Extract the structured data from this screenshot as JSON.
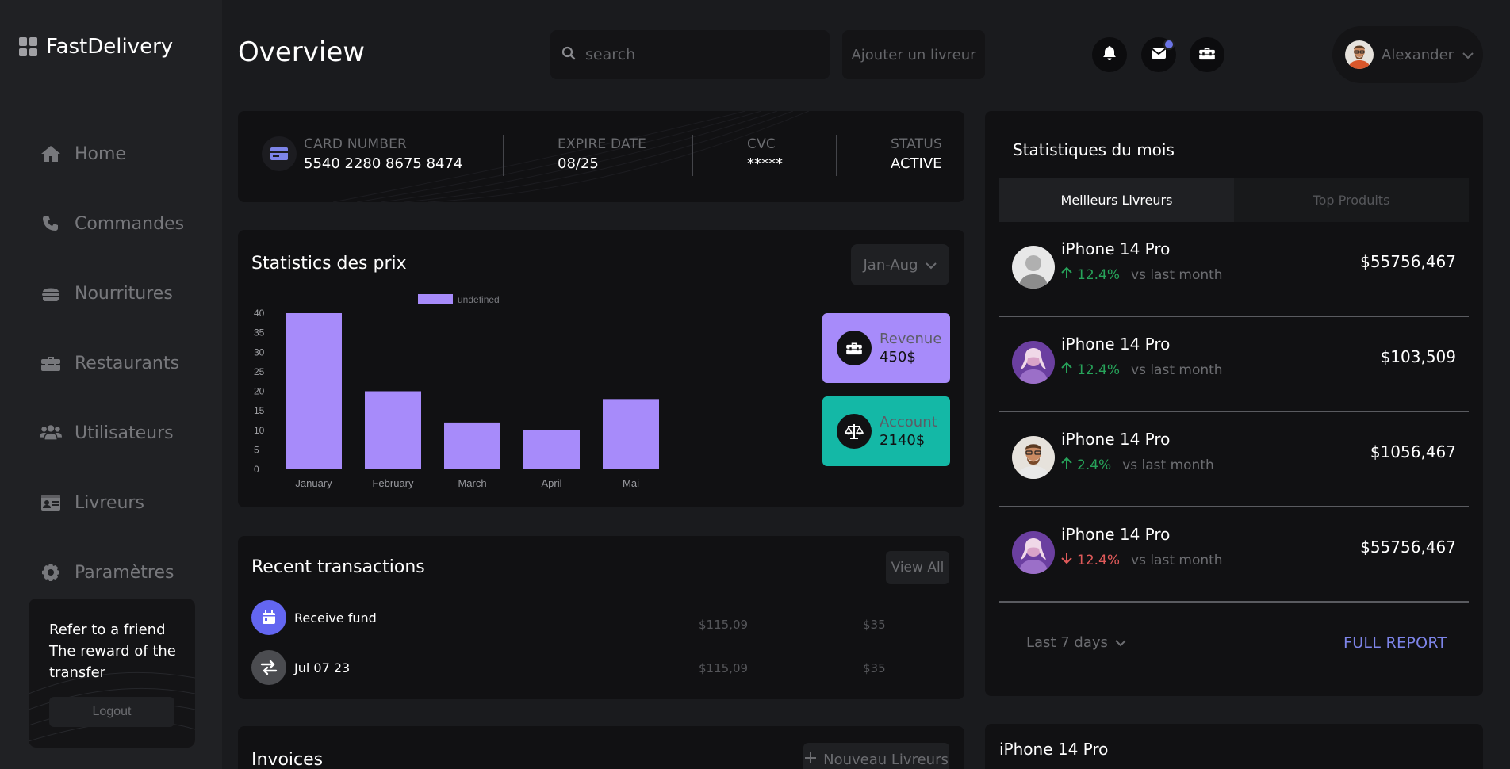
{
  "app": {
    "name": "FastDelivery"
  },
  "sidebar": {
    "items": [
      {
        "label": "Home",
        "icon": "home-icon"
      },
      {
        "label": "Commandes",
        "icon": "phone-icon"
      },
      {
        "label": "Nourritures",
        "icon": "burger-icon"
      },
      {
        "label": "Restaurants",
        "icon": "toolbox-icon"
      },
      {
        "label": "Utilisateurs",
        "icon": "users-icon"
      },
      {
        "label": "Livreurs",
        "icon": "id-card-icon"
      },
      {
        "label": "Paramètres",
        "icon": "gear-icon"
      }
    ],
    "refer": {
      "line1": "Refer to a friend",
      "line2": "The reward of the transfer",
      "logout_label": "Logout"
    }
  },
  "header": {
    "title": "Overview",
    "search_placeholder": "search",
    "add_label": "Ajouter un livreur",
    "user_name": "Alexander",
    "notification_dot_color": "#6b74e6"
  },
  "card": {
    "number_label": "CARD NUMBER",
    "number_value": "5540 2280 8675 8474",
    "expire_label": "EXPIRE DATE",
    "expire_value": "08/25",
    "cvc_label": "CVC",
    "cvc_value": "*****",
    "status_label": "STATUS",
    "status_value": "ACTIVE"
  },
  "stats": {
    "title": "Statistics des prix",
    "period": "Jan-Aug",
    "revenue_label": "Revenue",
    "revenue_value": "450$",
    "account_label": "Account",
    "account_value": "2140$",
    "revenue_color": "#a78bfa",
    "account_color": "#14b8a6"
  },
  "chart_data": {
    "type": "bar",
    "categories": [
      "January",
      "February",
      "March",
      "April",
      "Mai"
    ],
    "series": [
      {
        "name": "undefined",
        "values": [
          40,
          20,
          12,
          10,
          18
        ],
        "color": "#a78bfa"
      }
    ],
    "ylim": [
      0,
      40
    ],
    "yticks": [
      0,
      5,
      10,
      15,
      20,
      25,
      30,
      35,
      40
    ],
    "legend": "top-center",
    "grid": false
  },
  "transactions": {
    "title": "Recent transactions",
    "view_all": "View All",
    "rows": [
      {
        "label": "Receive fund",
        "amount1": "$115,09",
        "amount2": "$35",
        "icon": "calendar-icon",
        "color": "#6366f1"
      },
      {
        "label": "Jul 07 23",
        "amount1": "$115,09",
        "amount2": "$35",
        "icon": "swap-arrows-icon",
        "color": "#4b4c50"
      }
    ]
  },
  "invoices": {
    "title": "Invoices",
    "new_label": "Nouveau Livreurs"
  },
  "monthly": {
    "title": "Statistiques du mois",
    "tabs": [
      "Meilleurs Livreurs",
      "Top Produits"
    ],
    "couriers": [
      {
        "name": "iPhone 14 Pro",
        "trend": "12.4%",
        "direction": "up",
        "vs": "vs last month",
        "amount": "$55756,467"
      },
      {
        "name": "iPhone 14 Pro",
        "trend": "12.4%",
        "direction": "up",
        "vs": "vs last month",
        "amount": "$103,509"
      },
      {
        "name": "iPhone 14 Pro",
        "trend": "2.4%",
        "direction": "up",
        "vs": "vs last month",
        "amount": "$1056,467"
      },
      {
        "name": "iPhone 14 Pro",
        "trend": "12.4%",
        "direction": "down",
        "vs": "vs last month",
        "amount": "$55756,467"
      }
    ],
    "range": "Last 7 days",
    "full_report": "FULL REPORT"
  },
  "product": {
    "title": "iPhone 14 Pro"
  }
}
